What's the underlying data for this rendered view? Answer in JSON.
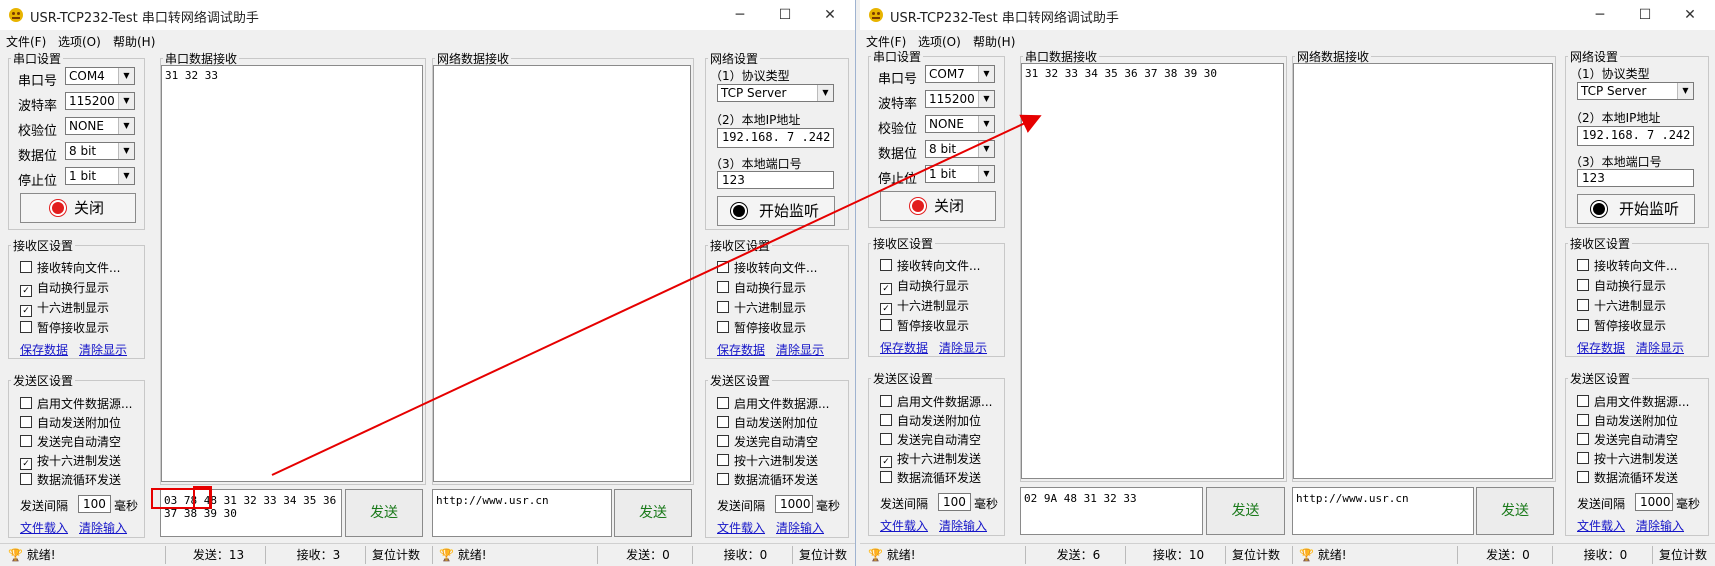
{
  "app_title": "USR-TCP232-Test 串口转网络调试助手",
  "window_controls": {
    "minimize": "─",
    "maximize": "☐",
    "close": "✕"
  },
  "menu": [
    "文件(F)",
    "选项(O)",
    "帮助(H)"
  ],
  "labels": {
    "serial_settings": "串口设置",
    "port": "串口号",
    "baud": "波特率",
    "parity": "校验位",
    "databits": "数据位",
    "stopbits": "停止位",
    "close_btn": "关闭",
    "recv_settings": "接收区设置",
    "recv_to_file": "接收转向文件...",
    "auto_newline": "自动换行显示",
    "hex_display": "十六进制显示",
    "pause_recv": "暂停接收显示",
    "save_data": "保存数据",
    "clear_display": "清除显示",
    "send_settings": "发送区设置",
    "file_source": "启用文件数据源...",
    "auto_append": "自动发送附加位",
    "auto_clear": "发送完自动清空",
    "hex_send": "按十六进制发送",
    "loop_send": "数据流循环发送",
    "send_interval": "发送间隔",
    "ms": "毫秒",
    "file_load": "文件载入",
    "clear_input": "清除输入",
    "serial_recv": "串口数据接收",
    "net_recv": "网络数据接收",
    "send": "发送",
    "net_settings": "网络设置",
    "protocol": "（1）协议类型",
    "local_ip": "（2）本地IP地址",
    "local_port": "（3）本地端口号",
    "listen_btn": "开始监听",
    "status_ready": "就绪!",
    "reset_count": "复位计数"
  },
  "left": {
    "port": "COM4",
    "baud": "115200",
    "parity": "NONE",
    "databits": "8 bit",
    "stopbits": "1 bit",
    "serial_recv_text": "31 32 33",
    "serial_send_text": "03 78 48 31 32 33 34 35 36 37 38 39 30",
    "net_send_text": "http://www.usr.cn",
    "serial_interval": "100",
    "net_interval": "1000",
    "protocol": "TCP Server",
    "ip": "192.168. 7 .242",
    "lport": "123",
    "status_serial_send": "发送：13",
    "status_serial_recv": "接收：3",
    "status_net_send": "发送：0",
    "status_net_recv": "接收：0",
    "chk_hex_send": true
  },
  "right": {
    "port": "COM7",
    "baud": "115200",
    "parity": "NONE",
    "databits": "8 bit",
    "stopbits": "1 bit",
    "serial_recv_text": "31 32 33 34 35 36 37 38 39 30",
    "serial_send_text": "02 9A 48 31 32 33",
    "net_send_text": "http://www.usr.cn",
    "serial_interval": "100",
    "net_interval": "1000",
    "protocol": "TCP Server",
    "ip": "192.168. 7 .242",
    "lport": "123",
    "status_serial_send": "发送：6",
    "status_serial_recv": "接收：10",
    "status_net_send": "发送：0",
    "status_net_recv": "接收：0",
    "chk_hex_send": true
  },
  "annotation": {
    "arrow_color": "#e60000",
    "box_color": "#e60000"
  }
}
